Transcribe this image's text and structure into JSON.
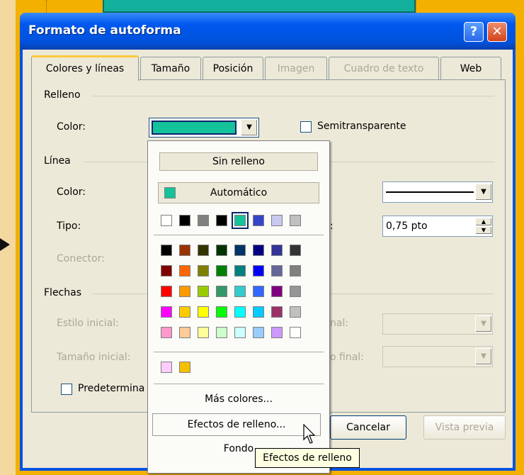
{
  "window": {
    "title": "Formato de autoforma",
    "help_glyph": "?",
    "close_glyph": "✕"
  },
  "tabs": [
    {
      "label": "Colores y líneas",
      "active": true,
      "enabled": true
    },
    {
      "label": "Tamaño",
      "active": false,
      "enabled": true
    },
    {
      "label": "Posición",
      "active": false,
      "enabled": true
    },
    {
      "label": "Imagen",
      "active": false,
      "enabled": false
    },
    {
      "label": "Cuadro de texto",
      "active": false,
      "enabled": false
    },
    {
      "label": "Web",
      "active": false,
      "enabled": true
    }
  ],
  "fill": {
    "group_label": "Relleno",
    "color_label": "Color:",
    "color_value": "#14c39a",
    "semitransparent_label": "Semitransparente",
    "semitransparent_checked": false
  },
  "line": {
    "group_label": "Línea",
    "color_label": "Color:",
    "type_label": "Tipo:",
    "connector_label": "Conector:",
    "weight_value": "0,75 pto"
  },
  "arrows": {
    "group_label": "Flechas",
    "start_style_label": "Estilo inicial:",
    "start_size_label": "Tamaño inicial:",
    "end_style_partial": "nal:",
    "end_size_partial": "o final:",
    "default_label_partial": "Predetermina"
  },
  "buttons": {
    "cancel": "Cancelar",
    "preview": "Vista previa"
  },
  "popup": {
    "no_fill": "Sin relleno",
    "automatic": "Automático",
    "automatic_color": "#14c39a",
    "recent_colors": [
      "#ffffff",
      "#000000",
      "#808080",
      "#000000",
      "#14c39a",
      "#3345c8",
      "#c8c8f0",
      "#c0c0c0"
    ],
    "palette": [
      [
        "#000000",
        "#993300",
        "#333300",
        "#003300",
        "#003366",
        "#000080",
        "#333399",
        "#333333"
      ],
      [
        "#800000",
        "#ff6600",
        "#808000",
        "#008000",
        "#008080",
        "#0000ff",
        "#666699",
        "#808080"
      ],
      [
        "#ff0000",
        "#ff9900",
        "#99cc00",
        "#339966",
        "#33cccc",
        "#3366ff",
        "#800080",
        "#969696"
      ],
      [
        "#ff00ff",
        "#ffcc00",
        "#ffff00",
        "#00ff00",
        "#00ffff",
        "#00ccff",
        "#993366",
        "#c0c0c0"
      ],
      [
        "#ff99cc",
        "#ffcc99",
        "#ffff99",
        "#ccffcc",
        "#ccffff",
        "#99ccff",
        "#cc99ff",
        "#ffffff"
      ]
    ],
    "custom_colors": [
      "#ffccff",
      "#f5c000"
    ],
    "more_colors": "Más colores...",
    "fill_effects": "Efectos de relleno...",
    "background": "Fondo"
  },
  "tooltip": {
    "text": "Efectos de relleno"
  }
}
